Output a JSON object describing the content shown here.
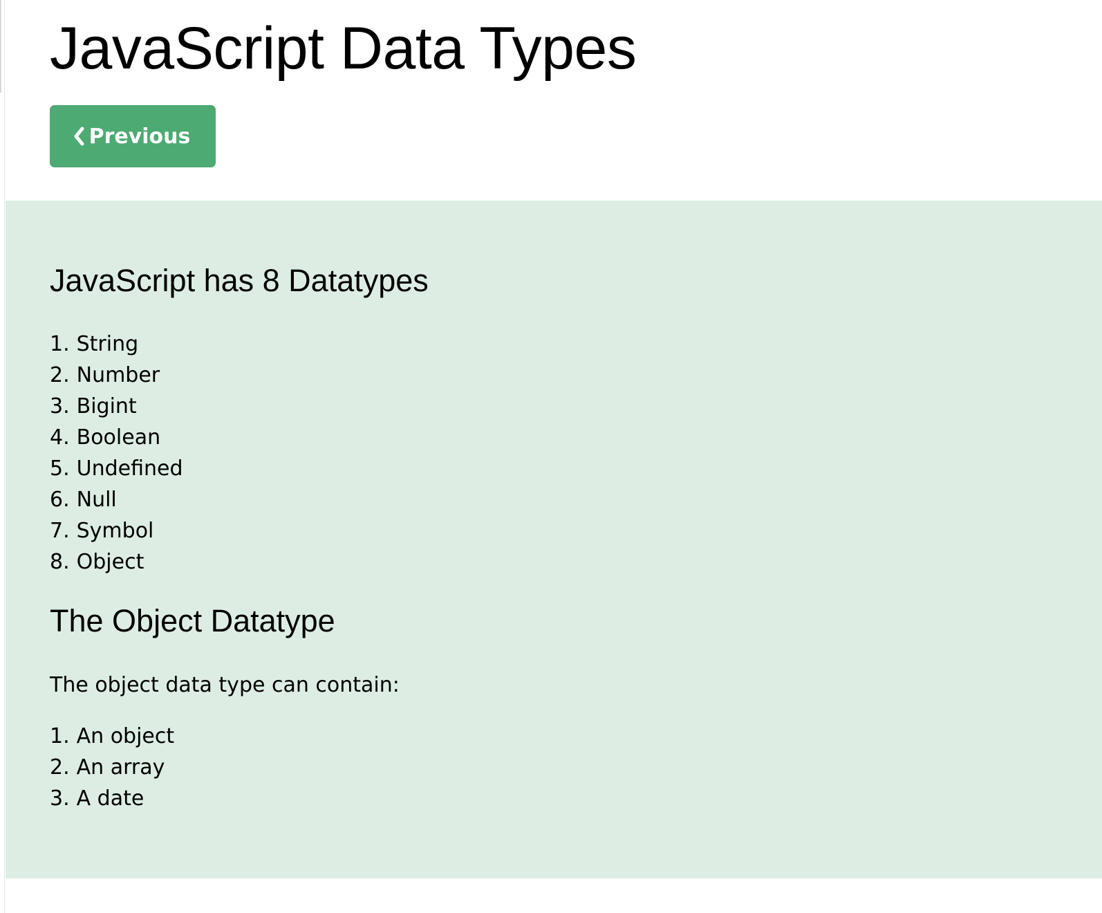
{
  "header": {
    "title": "JavaScript Data Types",
    "previous_button": {
      "label": "Previous",
      "icon": "chevron-left-icon"
    }
  },
  "section_datatypes": {
    "heading": "JavaScript has 8 Datatypes",
    "items": [
      {
        "number": "1.",
        "label": "String"
      },
      {
        "number": "2.",
        "label": "Number"
      },
      {
        "number": "3.",
        "label": "Bigint"
      },
      {
        "number": "4.",
        "label": "Boolean"
      },
      {
        "number": "5.",
        "label": "Undefined"
      },
      {
        "number": "6.",
        "label": "Null"
      },
      {
        "number": "7.",
        "label": "Symbol"
      },
      {
        "number": "8.",
        "label": "Object"
      }
    ]
  },
  "section_object": {
    "heading": "The Object Datatype",
    "description": "The object data type can contain:",
    "items": [
      {
        "number": "1.",
        "label": "An object"
      },
      {
        "number": "2.",
        "label": "An array"
      },
      {
        "number": "3.",
        "label": "A date"
      }
    ]
  },
  "colors": {
    "button_green": "#4caa72",
    "panel_background": "#ddede3"
  }
}
